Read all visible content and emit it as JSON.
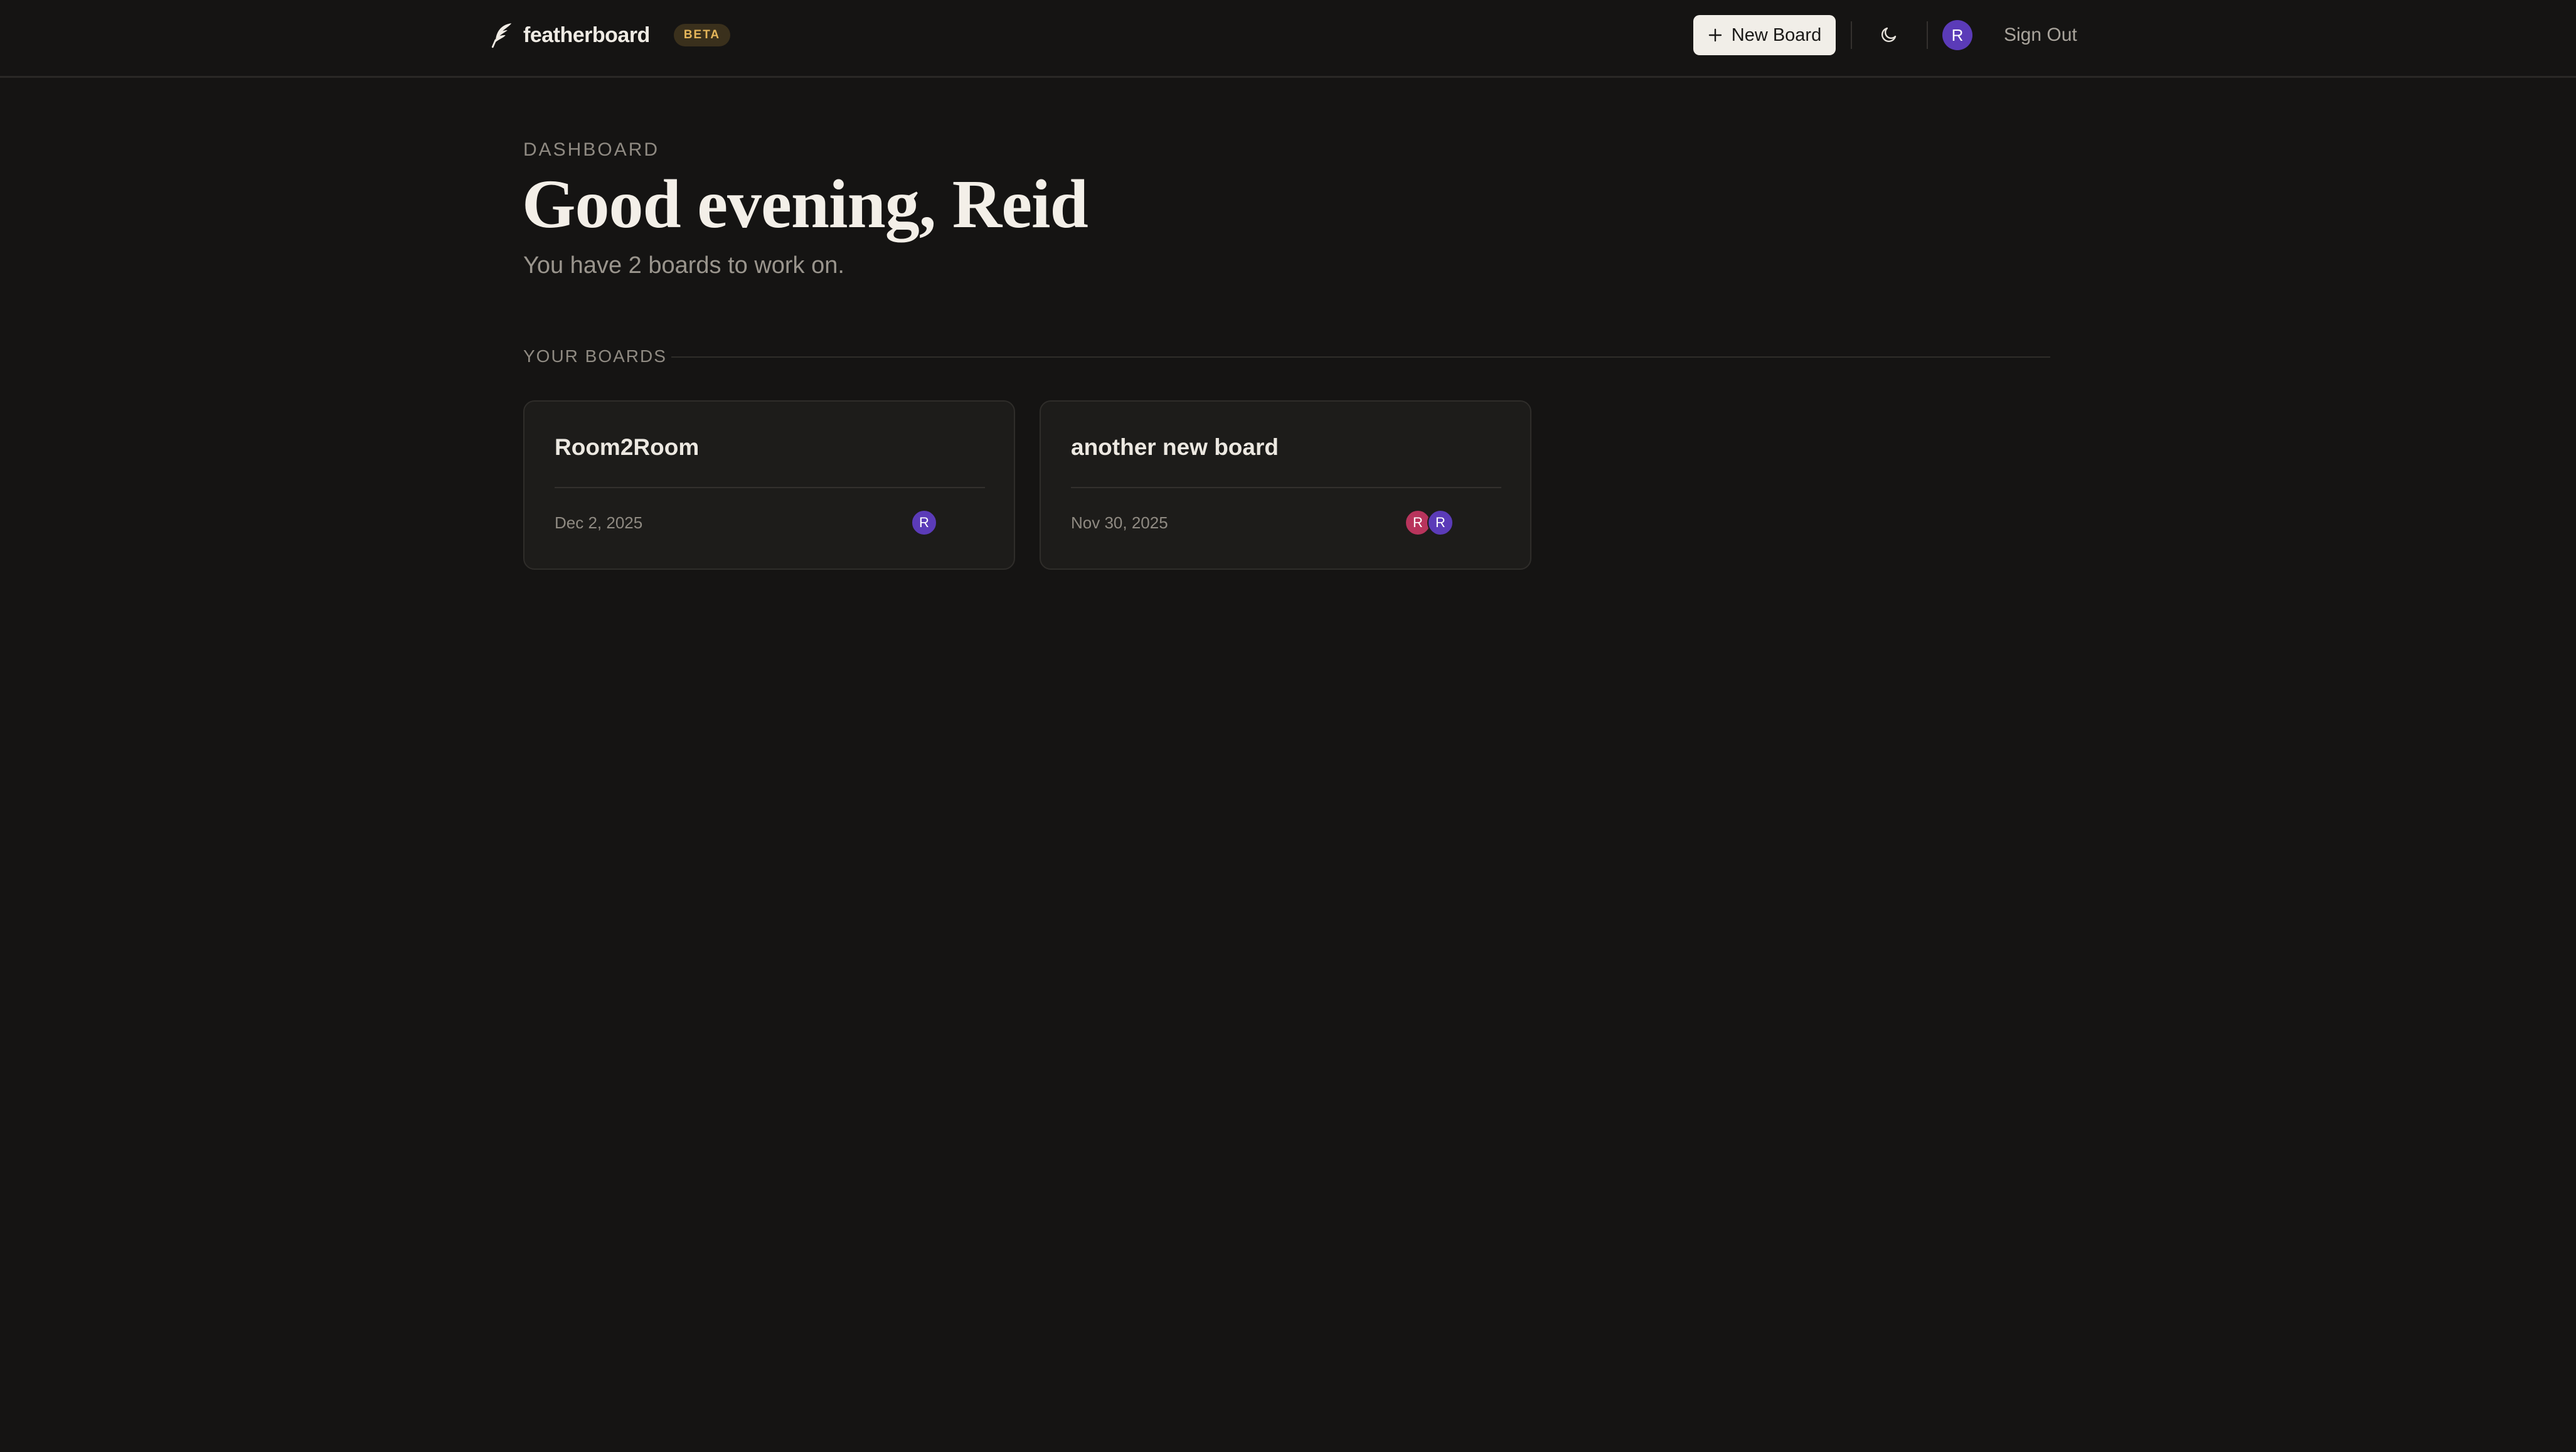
{
  "nav": {
    "brand": "featherboard",
    "badge": "BETA",
    "new_board_label": "New Board",
    "user_initial": "R",
    "sign_out_label": "Sign Out",
    "icons": {
      "logo": "feather-icon",
      "new_board": "plus-icon",
      "theme": "moon-icon"
    }
  },
  "header": {
    "eyebrow": "DASHBOARD",
    "greeting": "Good evening, Reid",
    "subtitle": "You have 2 boards to work on."
  },
  "section": {
    "label": "YOUR BOARDS"
  },
  "boards": [
    {
      "title": "Room2Room",
      "date": "Dec 2, 2025",
      "members": [
        {
          "initial": "R",
          "color": "#5b3bb8"
        }
      ]
    },
    {
      "title": "another new board",
      "date": "Nov 30, 2025",
      "members": [
        {
          "initial": "R",
          "color": "#b8345c"
        },
        {
          "initial": "R",
          "color": "#5b3bb8"
        }
      ]
    }
  ],
  "colors": {
    "background": "#151413",
    "card": "#1d1c1a",
    "beta_text": "#e5b65a",
    "avatar_purple": "#5b3bb8",
    "avatar_pink": "#b8345c"
  }
}
